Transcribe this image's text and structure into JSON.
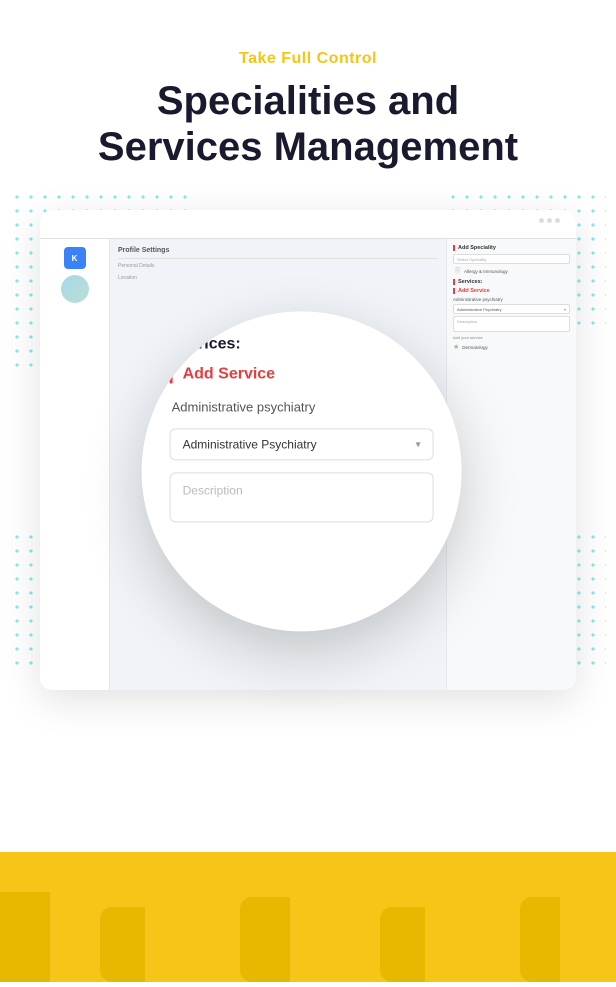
{
  "header": {
    "tagline": "Take Full Control",
    "title_line1": "Specialities and",
    "title_line2": "Services Management"
  },
  "mockup": {
    "header_text": "Profile Settings",
    "personal_details": "Personal Details",
    "location": "Location",
    "right_panel": {
      "add_speciality": "Add Speciality",
      "select_speciality": "Select Speciality",
      "allergy_item": "Allergy & Immunology",
      "services_label": "Services:",
      "add_service": "Add Service",
      "admin_psychiatry_small": "Administrative psychiatry",
      "dropdown_value": "Administrative Psychiatry",
      "description_placeholder": "Description",
      "add_your_service": "Add your service",
      "dermatology": "Dermatology"
    }
  },
  "circle": {
    "services_label": "Services:",
    "add_service_label": "Add Service",
    "service_name": "Administrative psychiatry",
    "dropdown_value": "Administrative Psychiatry",
    "description_placeholder": "Description"
  },
  "icons": {
    "chevron_down": "▾",
    "tooth": "🦷",
    "star": "★"
  },
  "colors": {
    "accent_yellow": "#f5c518",
    "accent_red": "#e53e3e",
    "accent_blue": "#3b82f6",
    "accent_teal": "#00d4d4",
    "dark": "#1a1a2e",
    "yellow_dark": "#e6b800"
  }
}
